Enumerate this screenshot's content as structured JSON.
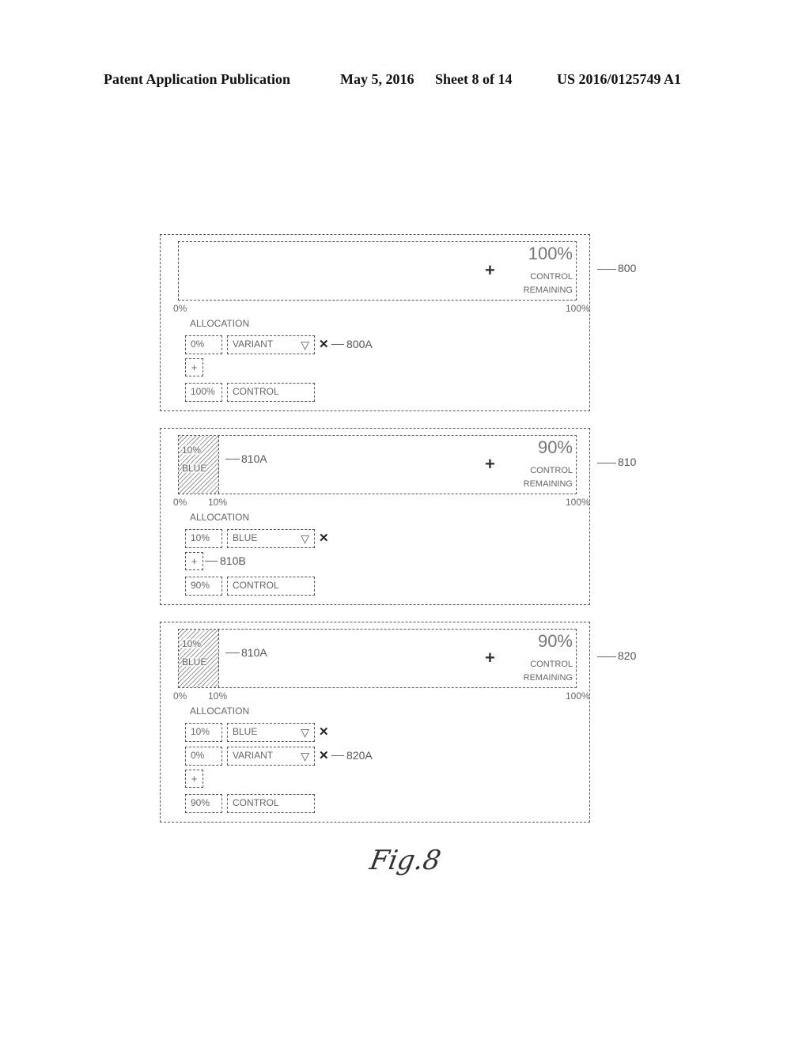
{
  "header": {
    "publication": "Patent Application Publication",
    "date": "May 5, 2016",
    "sheet": "Sheet 8 of 14",
    "number": "US 2016/0125749 A1"
  },
  "figure_label": "Fig.8",
  "panels": [
    {
      "ref": "800",
      "bar": {
        "allocated_fraction": 0,
        "allocated_label_pct": "",
        "allocated_label_name": "",
        "remaining_pct": "100%",
        "remaining_label_1": "CONTROL",
        "remaining_label_2": "REMAINING",
        "add_symbol": "+",
        "tick_start": "0%",
        "tick_split": "",
        "tick_end": "100%",
        "fill_ref": ""
      },
      "allocation_label": "ALLOCATION",
      "rows": [
        {
          "percent": "0%",
          "variant": "VARIANT",
          "ref": "800A"
        }
      ],
      "add_button": {
        "label": "+",
        "ref": ""
      },
      "control_row": {
        "percent": "100%",
        "name": "CONTROL"
      }
    },
    {
      "ref": "810",
      "bar": {
        "allocated_fraction": 0.1,
        "allocated_label_pct": "10%",
        "allocated_label_name": "BLUE",
        "remaining_pct": "90%",
        "remaining_label_1": "CONTROL",
        "remaining_label_2": "REMAINING",
        "add_symbol": "+",
        "tick_start": "0%",
        "tick_split": "10%",
        "tick_end": "100%",
        "fill_ref": "810A"
      },
      "allocation_label": "ALLOCATION",
      "rows": [
        {
          "percent": "10%",
          "variant": "BLUE",
          "ref": ""
        }
      ],
      "add_button": {
        "label": "+",
        "ref": "810B"
      },
      "control_row": {
        "percent": "90%",
        "name": "CONTROL"
      }
    },
    {
      "ref": "820",
      "bar": {
        "allocated_fraction": 0.1,
        "allocated_label_pct": "10%",
        "allocated_label_name": "BLUE",
        "remaining_pct": "90%",
        "remaining_label_1": "CONTROL",
        "remaining_label_2": "REMAINING",
        "add_symbol": "+",
        "tick_start": "0%",
        "tick_split": "10%",
        "tick_end": "100%",
        "fill_ref": "810A"
      },
      "allocation_label": "ALLOCATION",
      "rows": [
        {
          "percent": "10%",
          "variant": "BLUE",
          "ref": ""
        },
        {
          "percent": "0%",
          "variant": "VARIANT",
          "ref": "820A"
        }
      ],
      "add_button": {
        "label": "+",
        "ref": ""
      },
      "control_row": {
        "percent": "90%",
        "name": "CONTROL"
      }
    }
  ],
  "icons": {
    "dropdown": "▽",
    "delete": "✕"
  }
}
